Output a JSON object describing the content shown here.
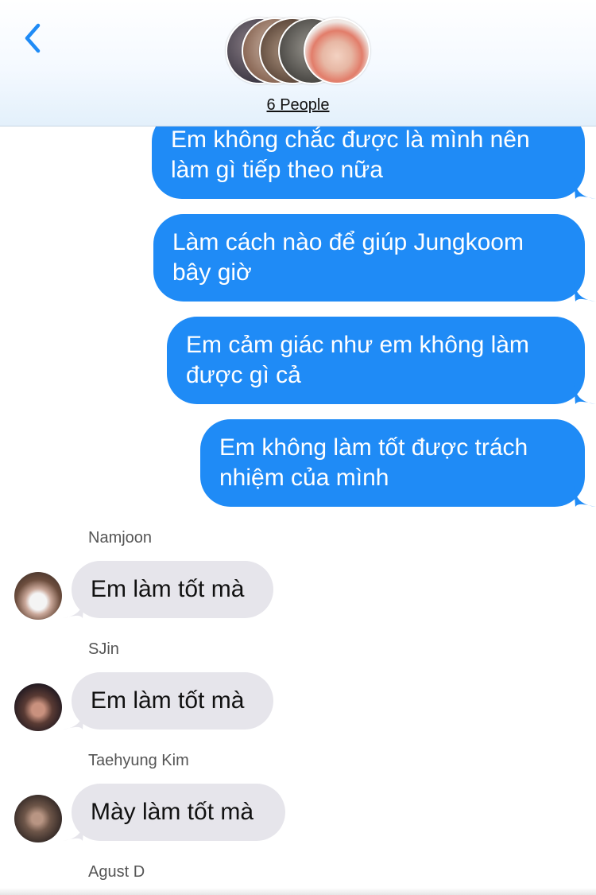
{
  "header": {
    "title": "6 People",
    "back_icon": "chevron-left-icon"
  },
  "colors": {
    "accent": "#1f8bf6",
    "incoming_bubble": "#e6e5eb"
  },
  "outgoing": [
    {
      "text": "Em không chắc được là mình nên làm gì tiếp theo nữa"
    },
    {
      "text": "Làm cách nào để giúp Jungkoom bây giờ"
    },
    {
      "text": "Em cảm giác như em không làm được gì cả"
    },
    {
      "text": "Em không làm tốt được trách nhiệm của mình"
    }
  ],
  "incoming": [
    {
      "sender": "Namjoon",
      "text": "Em làm tốt mà"
    },
    {
      "sender": "SJin",
      "text": "Em làm tốt mà"
    },
    {
      "sender": "Taehyung Kim",
      "text": "Mày làm tốt mà"
    },
    {
      "sender": "Agust D"
    }
  ]
}
